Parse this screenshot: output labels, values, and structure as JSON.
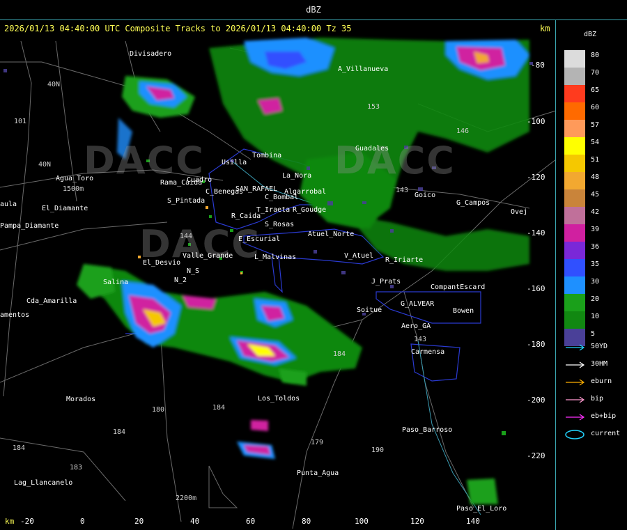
{
  "window_title": "dBZ",
  "map_title": "2026/01/13 04:40:00 UTC Composite Tracks to 2026/01/13 04:40:00 Tz 35",
  "km_top": "km",
  "km_bottom": "km",
  "watermark": "DACC",
  "x_axis_ticks": [
    "-20",
    "0",
    "20",
    "40",
    "60",
    "80",
    "100",
    "120",
    "140"
  ],
  "y_axis_ticks": [
    "-80",
    "-100",
    "-120",
    "-140",
    "-160",
    "-180",
    "-200",
    "-220"
  ],
  "place_labels": [
    {
      "id": "divisadero",
      "text": "Divisadero"
    },
    {
      "id": "a-villanueva",
      "text": "A_Villanueva"
    },
    {
      "id": "40n-a",
      "text": "40N"
    },
    {
      "id": "101",
      "text": "101"
    },
    {
      "id": "40n-b",
      "text": "40N"
    },
    {
      "id": "agua-toro",
      "text": "Agua_Toro"
    },
    {
      "id": "1500m",
      "text": "1500m"
    },
    {
      "id": "aula",
      "text": "aula"
    },
    {
      "id": "el-diamante",
      "text": "El_Diamante"
    },
    {
      "id": "pampa-diamante",
      "text": "Pampa_Diamante"
    },
    {
      "id": "usilla",
      "text": "Usilla"
    },
    {
      "id": "tombina",
      "text": "Tombina"
    },
    {
      "id": "la-nora",
      "text": "La_Nora"
    },
    {
      "id": "rama-caida",
      "text": "Rama_Caida"
    },
    {
      "id": "cuadro",
      "text": "Cuadro"
    },
    {
      "id": "c-benegas",
      "text": "C_Benegas"
    },
    {
      "id": "san-rafael",
      "text": "SAN_RAFAEL"
    },
    {
      "id": "algarrobal",
      "text": "Algarrobal"
    },
    {
      "id": "s-pintada",
      "text": "S_Pintada"
    },
    {
      "id": "c-bombal",
      "text": "C_Bombal"
    },
    {
      "id": "t-iraeta",
      "text": "T_Iraeta"
    },
    {
      "id": "r-goudge",
      "text": "R_Goudge"
    },
    {
      "id": "r-caida",
      "text": "R_Caida"
    },
    {
      "id": "s-rosas",
      "text": "S_Rosas"
    },
    {
      "id": "atuel-norte",
      "text": "Atuel_Norte"
    },
    {
      "id": "e-escurial",
      "text": "E_Escurial"
    },
    {
      "id": "guadales",
      "text": "Guadales"
    },
    {
      "id": "goico",
      "text": "Goico"
    },
    {
      "id": "g-campos",
      "text": "G_Campos"
    },
    {
      "id": "ovejas",
      "text": "Ovej"
    },
    {
      "id": "146",
      "text": "146"
    },
    {
      "id": "153",
      "text": "153"
    },
    {
      "id": "143",
      "text": "143"
    },
    {
      "id": "144",
      "text": "144"
    },
    {
      "id": "el-desvio",
      "text": "El_Desvio"
    },
    {
      "id": "valle-grande",
      "text": "Valle_Grande"
    },
    {
      "id": "l-malvinas",
      "text": "L_Malvinas"
    },
    {
      "id": "v-atuel",
      "text": "V_Atuel"
    },
    {
      "id": "r-iriarte",
      "text": "R_Iriarte"
    },
    {
      "id": "j-prats",
      "text": "J_Prats"
    },
    {
      "id": "compant-escard",
      "text": "CompantEscard"
    },
    {
      "id": "salina",
      "text": "Salina"
    },
    {
      "id": "n-s",
      "text": "N_S"
    },
    {
      "id": "n-2",
      "text": "N_2"
    },
    {
      "id": "cda-amarilla",
      "text": "Cda_Amarilla"
    },
    {
      "id": "amentos",
      "text": "amentos"
    },
    {
      "id": "soitue",
      "text": "Soitue"
    },
    {
      "id": "g-alvear",
      "text": "G_ALVEAR"
    },
    {
      "id": "bowen",
      "text": "Bowen"
    },
    {
      "id": "aero-gh",
      "text": "Aero_GA"
    },
    {
      "id": "carmensa",
      "text": "Carmensa"
    },
    {
      "id": "143b",
      "text": "143"
    },
    {
      "id": "184a",
      "text": "184"
    },
    {
      "id": "los-toldos",
      "text": "Los_Toldos"
    },
    {
      "id": "morados",
      "text": "Morados"
    },
    {
      "id": "180",
      "text": "180"
    },
    {
      "id": "184b",
      "text": "184"
    },
    {
      "id": "184c",
      "text": "184"
    },
    {
      "id": "184d",
      "text": "184"
    },
    {
      "id": "183",
      "text": "183"
    },
    {
      "id": "179",
      "text": "179"
    },
    {
      "id": "190",
      "text": "190"
    },
    {
      "id": "paso-barroso",
      "text": "Paso_Barroso"
    },
    {
      "id": "lag-llancanelo",
      "text": "Lag_Llancanelo"
    },
    {
      "id": "punta-agua",
      "text": "Punta_Agua"
    },
    {
      "id": "2200m",
      "text": "2200m"
    },
    {
      "id": "paso-el-loro",
      "text": "Paso_El_Loro"
    }
  ],
  "legend": {
    "unit": "dBZ",
    "scale": [
      {
        "label": "80",
        "color": "#dcdcdc"
      },
      {
        "label": "70",
        "color": "#b4b4b4"
      },
      {
        "label": "65",
        "color": "#ff3b1e"
      },
      {
        "label": "60",
        "color": "#ff6a00"
      },
      {
        "label": "57",
        "color": "#ff9a5a"
      },
      {
        "label": "54",
        "color": "#ffff00"
      },
      {
        "label": "51",
        "color": "#f5c800"
      },
      {
        "label": "48",
        "color": "#f2a830"
      },
      {
        "label": "45",
        "color": "#c9843a"
      },
      {
        "label": "42",
        "color": "#c0709a"
      },
      {
        "label": "39",
        "color": "#d020a0"
      },
      {
        "label": "36",
        "color": "#7a28d8"
      },
      {
        "label": "35",
        "color": "#3050ff"
      },
      {
        "label": "30",
        "color": "#1e90ff"
      },
      {
        "label": "20",
        "color": "#1aa01a"
      },
      {
        "label": "10",
        "color": "#118811"
      },
      {
        "label": "5",
        "color": "#4a4098"
      }
    ],
    "tracks": [
      {
        "label": "50YD",
        "color": "#22d4ff",
        "kind": "arrow"
      },
      {
        "label": "30HM",
        "color": "#ffffff",
        "kind": "arrow"
      },
      {
        "label": "eburn",
        "color": "#ffb000",
        "kind": "arrow"
      },
      {
        "label": "bip",
        "color": "#ff9ad0",
        "kind": "arrow"
      },
      {
        "label": "eb+bip",
        "color": "#ff30ff",
        "kind": "arrow"
      },
      {
        "label": "current",
        "color": "#22d4ff",
        "kind": "ellipse"
      }
    ]
  }
}
